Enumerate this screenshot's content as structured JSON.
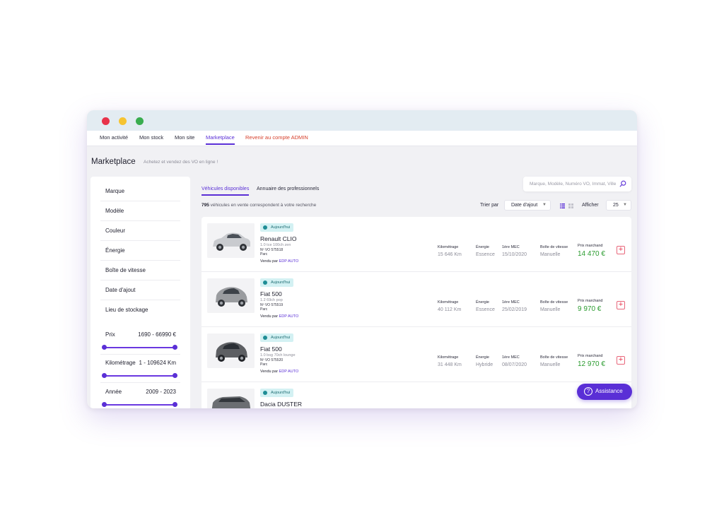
{
  "nav": {
    "items": [
      {
        "label": "Mon activité"
      },
      {
        "label": "Mon stock"
      },
      {
        "label": "Mon site"
      },
      {
        "label": "Marketplace"
      },
      {
        "label": "Revenir au compte ADMIN"
      }
    ],
    "active": "Marketplace"
  },
  "page": {
    "title": "Marketplace",
    "subtitle": "Achetez et vendez des VO en ligne !"
  },
  "filters": {
    "items": [
      {
        "label": "Marque"
      },
      {
        "label": "Modèle"
      },
      {
        "label": "Couleur"
      },
      {
        "label": "Énergie"
      },
      {
        "label": "Boîte de vitesse"
      },
      {
        "label": "Date d'ajout"
      },
      {
        "label": "Lieu de stockage"
      }
    ],
    "ranges": [
      {
        "label": "Prix",
        "value": "1690 - 66990 €"
      },
      {
        "label": "Kilométrage",
        "value": "1 - 109624 Km"
      },
      {
        "label": "Année",
        "value": "2009 - 2023"
      }
    ]
  },
  "tabs": [
    {
      "label": "Véhicules disponibles"
    },
    {
      "label": "Annuaire des professionnels"
    }
  ],
  "search": {
    "placeholder": "Marque, Modèle, Numéro VO, Immat, Ville"
  },
  "results": {
    "count": "795",
    "text": "véhicules en vente correspondent à votre recherche"
  },
  "sort": {
    "label": "Trier par",
    "value": "Date d'ajout"
  },
  "display": {
    "label": "Afficher",
    "value": "25"
  },
  "spec_labels": {
    "km": "Kilométrage",
    "energy": "Énergie",
    "mec": "1ère MEC",
    "gearbox": "Boîte de vitesse",
    "price": "Prix marchand"
  },
  "vehicles": [
    {
      "badge": "Aujourd'hui",
      "name": "Renault CLIO",
      "version": "1.0 tce 100ch zen",
      "ref": "Nº VO 575518",
      "location": "Parc",
      "seller_prefix": "Vendu par",
      "seller": "EDP AUTO",
      "km": "15 646 Km",
      "energy": "Essence",
      "mec": "15/10/2020",
      "gearbox": "Manuelle",
      "price": "14 470 €",
      "color": "#c9cbcf"
    },
    {
      "badge": "Aujourd'hui",
      "name": "Fiat 500",
      "version": "1.2 69ch pop",
      "ref": "Nº VO 575519",
      "location": "Parc",
      "seller_prefix": "Vendu par",
      "seller": "EDP AUTO",
      "km": "40 112 Km",
      "energy": "Essence",
      "mec": "25/02/2019",
      "gearbox": "Manuelle",
      "price": "9 970 €",
      "color": "#9a9c9f"
    },
    {
      "badge": "Aujourd'hui",
      "name": "Fiat 500",
      "version": "1.0 bsg 70ch lounge",
      "ref": "Nº VO 575520",
      "location": "Parc",
      "seller_prefix": "Vendu par",
      "seller": "EDP AUTO",
      "km": "31 448 Km",
      "energy": "Hybride",
      "mec": "08/07/2020",
      "gearbox": "Manuelle",
      "price": "12 970 €",
      "color": "#5d5f63"
    },
    {
      "badge": "Aujourd'hui",
      "name": "Dacia DUSTER",
      "color": "#6b6e72"
    }
  ],
  "assistance": {
    "label": "Assistance"
  },
  "colors": {
    "accent": "#5a2fd6",
    "price": "#2a9b2f",
    "admin": "#d6402c",
    "badge_bg": "#d3f1f3"
  }
}
